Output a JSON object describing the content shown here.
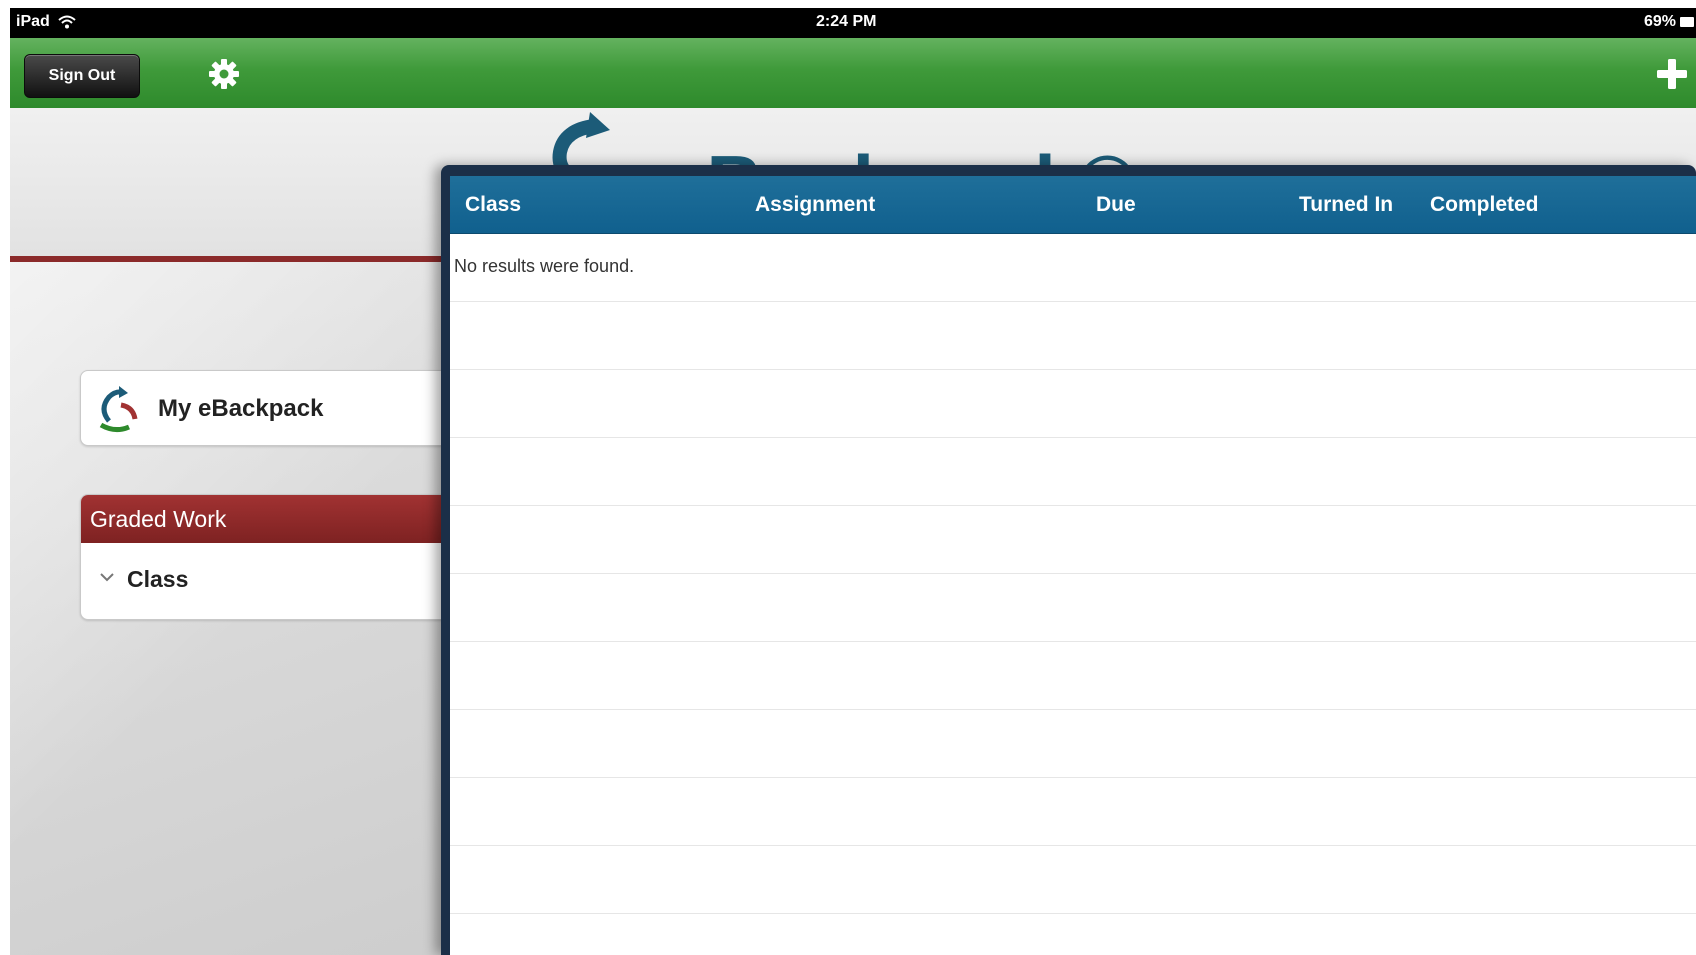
{
  "status_bar": {
    "device": "iPad",
    "time": "2:24 PM",
    "battery": "69%"
  },
  "toolbar": {
    "sign_out_label": "Sign Out"
  },
  "header": {
    "logo_text": "eBackpack®"
  },
  "sidebar": {
    "backpack_label": "My eBackpack",
    "graded_work": {
      "title": "Graded Work",
      "filter_label": "Class"
    }
  },
  "table": {
    "columns": [
      "Class",
      "Assignment",
      "Due",
      "Turned In",
      "Completed"
    ],
    "empty_message": "No results were found."
  },
  "colors": {
    "toolbar_green": "#3f9a3a",
    "brand_red": "#8b2a2a",
    "table_header_blue": "#1a6a96",
    "panel_frame": "#1b2f48"
  }
}
